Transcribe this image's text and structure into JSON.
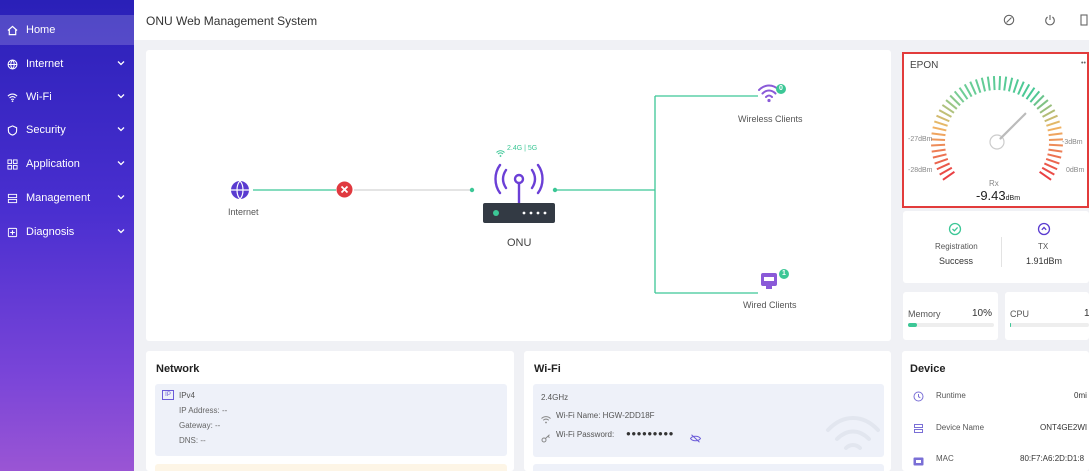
{
  "sidebar": {
    "items": [
      {
        "label": "Home",
        "icon": "home-icon"
      },
      {
        "label": "Internet",
        "icon": "globe-icon"
      },
      {
        "label": "Wi-Fi",
        "icon": "wifi-icon"
      },
      {
        "label": "Security",
        "icon": "shield-icon"
      },
      {
        "label": "Application",
        "icon": "apps-icon"
      },
      {
        "label": "Management",
        "icon": "management-icon"
      },
      {
        "label": "Diagnosis",
        "icon": "diagnosis-icon"
      }
    ]
  },
  "header": {
    "title": "ONU Web Management System"
  },
  "topology": {
    "internet_label": "Internet",
    "onu_label": "ONU",
    "band_label": "2.4G | 5G",
    "wireless_label": "Wireless Clients",
    "wireless_count": "0",
    "wired_label": "Wired Clients",
    "wired_count": "1"
  },
  "epon": {
    "title": "EPON",
    "menu": "••",
    "tick_left_top": "-27dBm",
    "tick_left_bottom": "-28dBm",
    "tick_right_top": "-3dBm",
    "tick_right_bottom": "0dBm",
    "rx_label": "Rx",
    "rx_value": "-9.43",
    "rx_unit": "dBm",
    "rx_level": 0.68
  },
  "status": {
    "registration_label": "Registration",
    "registration_value": "Success",
    "tx_label": "TX",
    "tx_value": "1.91dBm"
  },
  "usage": {
    "memory_label": "Memory",
    "memory_value": "10%",
    "memory_fraction": 0.1,
    "cpu_label": "CPU",
    "cpu_value": "1",
    "cpu_fraction": 0.01
  },
  "network": {
    "title": "Network",
    "ipv4_badge": "IP",
    "ipv4_label": "IPv4",
    "ip_address": "IP Address:  --",
    "gateway": "Gateway:  --",
    "dns": "DNS:  --"
  },
  "wifi": {
    "title": "Wi-Fi",
    "band": "2.4GHz",
    "name": "Wi-Fi Name:  HGW-2DD18F",
    "password_label": "Wi-Fi Password:",
    "password_mask": "●●●●●●●●●"
  },
  "device": {
    "title": "Device",
    "runtime_label": "Runtime",
    "runtime_value": "0mi",
    "name_label": "Device Name",
    "name_value": "ONT4GE2WI",
    "mac_label": "MAC",
    "mac_value": "80:F7:A6:2D:D1:8"
  },
  "colors": {
    "accent": "#3a2fc7",
    "green": "#3cc796",
    "red": "#e0393f",
    "purple": "#8a5ad8"
  }
}
